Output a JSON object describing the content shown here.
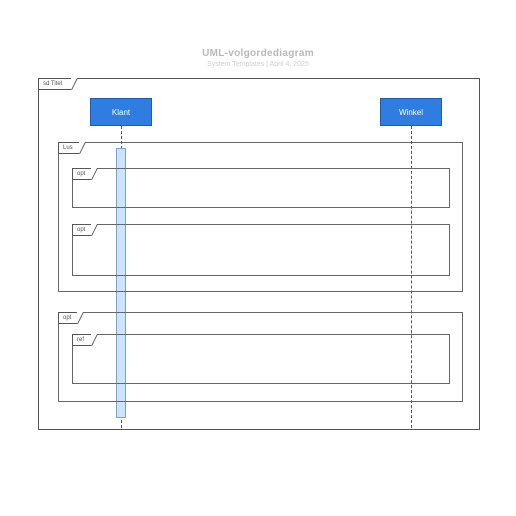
{
  "title": "UML-volgordediagram",
  "subtitle": "System Templates | April 4, 2025",
  "main_frame_label": "sd Titel",
  "actors": {
    "left": "Klant",
    "right": "Winkel"
  },
  "fragments": {
    "lus": "Lus",
    "opt1": "opt",
    "opt2": "opt",
    "opt3": "opt",
    "ref": "ref"
  }
}
